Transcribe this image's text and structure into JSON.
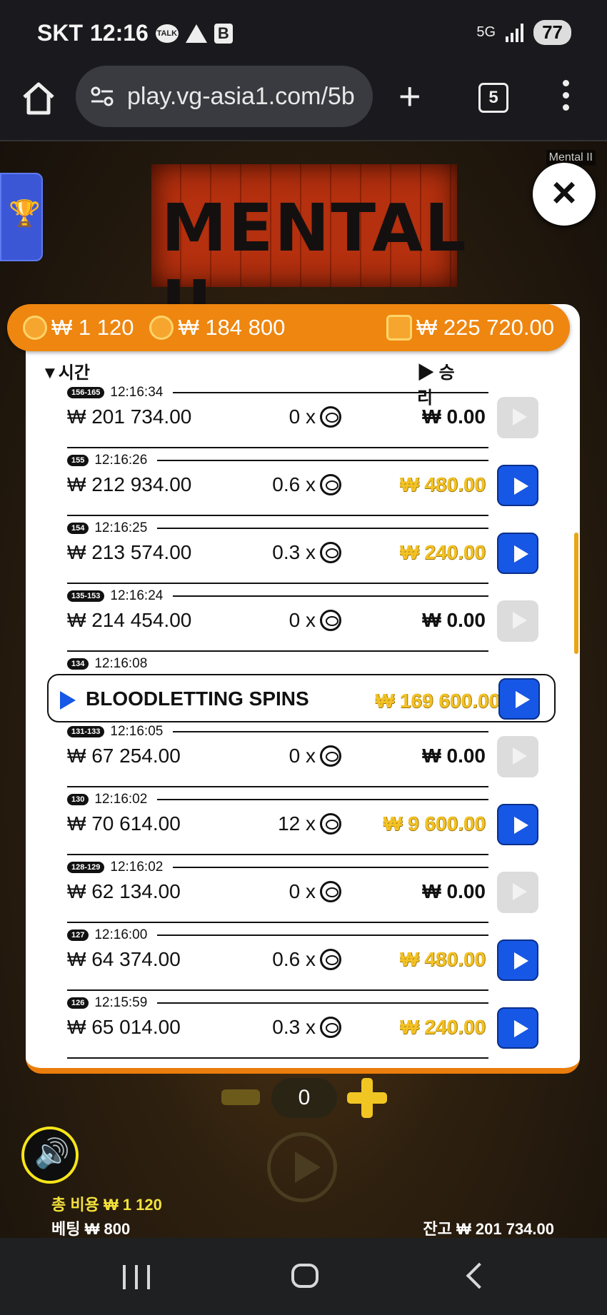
{
  "status_bar": {
    "carrier": "SKT",
    "time": "12:16",
    "talk": "TALK",
    "b_icon": "B",
    "network": "5G",
    "battery": "77"
  },
  "browser": {
    "url": "play.vg-asia1.com/5b",
    "tab_count": "5"
  },
  "game": {
    "label": "Mental II",
    "logo_text": "MENTAL II",
    "trophy": "🏆",
    "close": "×",
    "bar": {
      "bet_total": "₩ 1 120",
      "max_win": "₩ 184 800",
      "balance": "₩ 225 720.00"
    },
    "list_headers": {
      "time": "▼시간",
      "win": "▶ 승리"
    },
    "rows": [
      {
        "tag": "156-165",
        "time": "12:16:34",
        "balance": "₩ 201 734.00",
        "mult": "0 x",
        "win": "₩ 0.00",
        "winning": false
      },
      {
        "tag": "155",
        "time": "12:16:26",
        "balance": "₩ 212 934.00",
        "mult": "0.6 x",
        "win": "₩ 480.00",
        "winning": true
      },
      {
        "tag": "154",
        "time": "12:16:25",
        "balance": "₩ 213 574.00",
        "mult": "0.3 x",
        "win": "₩ 240.00",
        "winning": true
      },
      {
        "tag": "135-153",
        "time": "12:16:24",
        "balance": "₩ 214 454.00",
        "mult": "0 x",
        "win": "₩ 0.00",
        "winning": false
      },
      {
        "tag": "134",
        "time": "12:16:08",
        "bonus": "BLOODLETTING SPINS",
        "win": "₩ 169 600.00",
        "winning": true
      },
      {
        "tag": "131-133",
        "time": "12:16:05",
        "balance": "₩ 67 254.00",
        "mult": "0 x",
        "win": "₩ 0.00",
        "winning": false
      },
      {
        "tag": "130",
        "time": "12:16:02",
        "balance": "₩ 70 614.00",
        "mult": "12 x",
        "win": "₩ 9 600.00",
        "winning": true
      },
      {
        "tag": "128-129",
        "time": "12:16:02",
        "balance": "₩ 62 134.00",
        "mult": "0 x",
        "win": "₩ 0.00",
        "winning": false
      },
      {
        "tag": "127",
        "time": "12:16:00",
        "balance": "₩ 64 374.00",
        "mult": "0.6 x",
        "win": "₩ 480.00",
        "winning": true
      },
      {
        "tag": "126",
        "time": "12:15:59",
        "balance": "₩ 65 014.00",
        "mult": "0.3 x",
        "win": "₩ 240.00",
        "winning": true
      }
    ],
    "quantity": "0",
    "footer": {
      "total_cost": "총 비용 ₩ 1 120",
      "bet": "베팅 ₩ 800",
      "balance": "잔고 ₩ 201 734.00"
    }
  },
  "colors": {
    "orange": "#ee8610",
    "gold_win": "#f3c224",
    "play_blue": "#1657e6"
  }
}
